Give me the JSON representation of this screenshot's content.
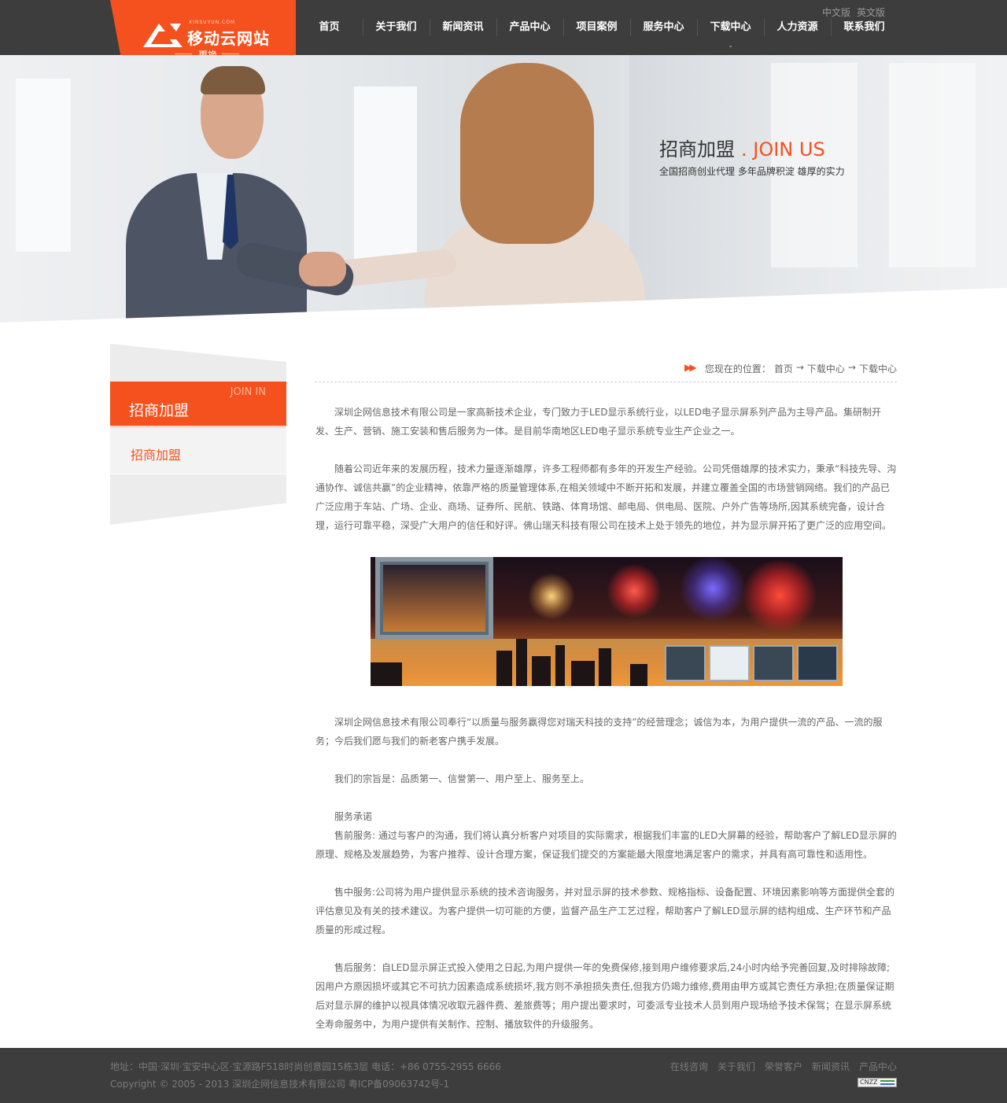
{
  "header": {
    "logo_small": "XINSUYUN.COM",
    "logo_text": "移动云网站",
    "logo_change": "更换",
    "nav": [
      "首页",
      "关于我们",
      "新闻资讯",
      "产品中心",
      "项目案例",
      "服务中心",
      "下载中心",
      "人力资源",
      "联系我们"
    ],
    "lang": [
      "中文版",
      "英文版"
    ]
  },
  "banner": {
    "title_cn": "招商加盟",
    "title_en": ". JOIN US",
    "subtitle": "全国招商创业代理 多年品牌积淀 雄厚的实力"
  },
  "sidebar": {
    "head_cn": "招商加盟",
    "head_en": "JOIN IN",
    "items": [
      "招商加盟"
    ]
  },
  "breadcrumb": {
    "prefix": "您现在的位置：",
    "items": [
      "首页",
      "下载中心",
      "下载中心"
    ],
    "sep": "→"
  },
  "article": {
    "p1": "深圳企网信息技术有限公司是一家高新技术企业，专门致力于LED显示系统行业，以LED电子显示屏系列产品为主导产品。集研制开发、生产、营销、施工安装和售后服务为一体。是目前华南地区LED电子显示系统专业生产企业之一。",
    "p2": "随着公司近年来的发展历程，技术力量逐渐雄厚，许多工程师都有多年的开发生产经验。公司凭借雄厚的技术实力，秉承“科技先导、沟通协作、诚信共赢”的企业精神，依靠严格的质量管理体系,在相关领域中不断开拓和发展，并建立覆盖全国的市场营销网络。我们的产品已广泛应用于车站、广场、企业、商场、证券所、民航、铁路、体育场馆、邮电局、供电局、医院、户外广告等场所,因其系统完备，设计合理，运行可靠平稳，深受广大用户的信任和好评。佛山瑞天科技有限公司在技术上处于领先的地位，并为显示屏开拓了更广泛的应用空间。",
    "p3": "深圳企网信息技术有限公司奉行“以质量与服务赢得您对瑞天科技的支持”的经营理念；诚信为本，为用户提供一流的产品、一流的服务；今后我们愿与我们的新老客户携手发展。",
    "p4": "我们的宗旨是：品质第一、信誉第一、用户至上、服务至上。",
    "p5_title": "服务承诺",
    "p5": "售前服务: 通过与客户的沟通，我们将认真分析客户对项目的实际需求，根据我们丰富的LED大屏幕的经验，帮助客户了解LED显示屏的原理、规格及发展趋势，为客户推荐、设计合理方案，保证我们提交的方案能最大限度地满足客户的需求，并具有高可靠性和适用性。",
    "p6": "售中服务:公司将为用户提供显示系统的技术咨询服务，并对显示屏的技术参数、规格指标、设备配置、环境因素影响等方面提供全套的评估意见及有关的技术建议。为客户提供一切可能的方便，监督产品生产工艺过程，帮助客户了解LED显示屏的结构组成、生产环节和产品质量的形成过程。",
    "p7": "售后服务：自LED显示屏正式投入使用之日起,为用户提供一年的免费保修,接到用户维修要求后,24小时内给予完善回复,及时排除故障;因用户方原因损坏或其它不可抗力因素造成系统损坏,我方则不承担损失责任,但我方仍竭力维修,费用由甲方或其它责任方承担;在质量保证期后对显示屏的维护以视具体情况收取元器件费、差旅费等；用户提出要求时，可委派专业技术人员到用户现场给予技术保驾；在显示屏系统全寿命服务中，为用户提供有关制作、控制、播放软件的升级服务。"
  },
  "footer": {
    "address": "地址：中国·深圳·宝安中心区·宝源路F518时尚创意园15栋3层 电话：+86 0755-2955 6666",
    "copyright": "Copyright © 2005 - 2013 深圳企网信息技术有限公司 粤ICP备09063742号-1",
    "links": [
      "在线咨询",
      "关于我们",
      "荣誉客户",
      "新闻资讯",
      "产品中心"
    ],
    "badge": "CNZZ"
  },
  "colors": {
    "accent": "#f4511e",
    "header_bg": "#3d3d3d"
  }
}
